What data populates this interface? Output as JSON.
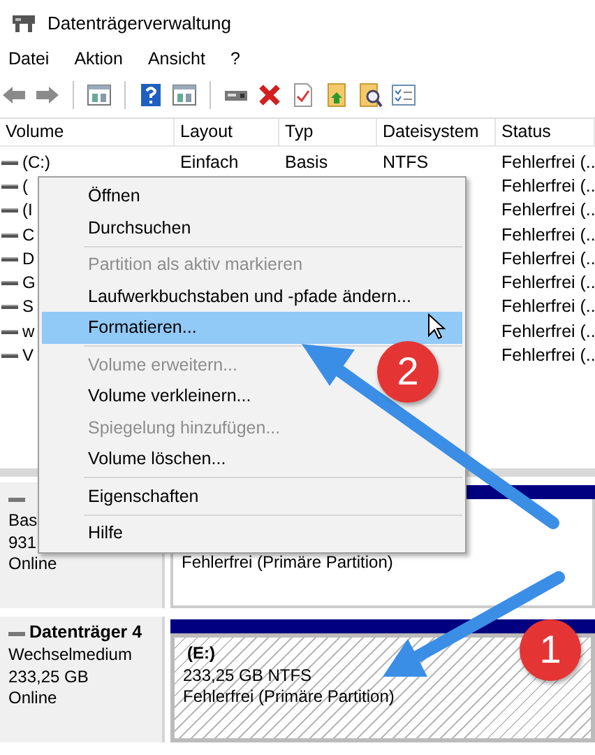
{
  "window": {
    "title": "Datenträgerverwaltung"
  },
  "menu_bar": [
    "Datei",
    "Aktion",
    "Ansicht",
    "?"
  ],
  "toolbar": [
    {
      "kind": "back"
    },
    {
      "kind": "forward"
    },
    {
      "kind": "separator"
    },
    {
      "kind": "panel"
    },
    {
      "kind": "separator"
    },
    {
      "kind": "help"
    },
    {
      "kind": "panel"
    },
    {
      "kind": "separator"
    },
    {
      "kind": "drive"
    },
    {
      "kind": "delete"
    },
    {
      "kind": "check"
    },
    {
      "kind": "folder-up"
    },
    {
      "kind": "folder-search"
    },
    {
      "kind": "list"
    }
  ],
  "volume_table": {
    "columns": [
      "Volume",
      "Layout",
      "Typ",
      "Dateisystem",
      "Status"
    ],
    "rows": [
      {
        "volume": "(C:)",
        "layout": "Einfach",
        "type": "Basis",
        "file_system": "NTFS",
        "status": "Fehlerfrei (.."
      },
      {
        "volume": "(",
        "status": "Fehlerfrei (.."
      },
      {
        "volume": "(I",
        "status": "Fehlerfrei (.."
      },
      {
        "volume": "C",
        "status": "Fehlerfrei (.."
      },
      {
        "volume": "D",
        "status": "Fehlerfrei (.."
      },
      {
        "volume": "G",
        "status": "Fehlerfrei (.."
      },
      {
        "volume": "S",
        "status": "Fehlerfrei (.."
      },
      {
        "volume": "w",
        "status": "Fehlerfrei (.."
      },
      {
        "volume": "V",
        "status": "Fehlerfrei (.."
      }
    ]
  },
  "disks": [
    {
      "type": "Bas",
      "size": "931",
      "status": "Online",
      "partitions": [
        {
          "status": "Fehlerfrei (Primäre Partition)",
          "selected": false
        }
      ]
    },
    {
      "name": "Datenträger 4",
      "type": "Wechselmedium",
      "size": "233,25 GB",
      "status": "Online",
      "partitions": [
        {
          "label": "(E:)",
          "size_fs": "233,25 GB NTFS",
          "status": "Fehlerfrei (Primäre Partition)",
          "selected": true
        }
      ]
    }
  ],
  "context_menu": [
    {
      "kind": "item",
      "label": "Öffnen",
      "disabled": false,
      "selected": false
    },
    {
      "kind": "item",
      "label": "Durchsuchen",
      "disabled": false,
      "selected": false
    },
    {
      "kind": "separator"
    },
    {
      "kind": "item",
      "label": "Partition als aktiv markieren",
      "disabled": true,
      "selected": false
    },
    {
      "kind": "item",
      "label": "Laufwerkbuchstaben und -pfade ändern...",
      "disabled": false,
      "selected": false
    },
    {
      "kind": "item",
      "label": "Formatieren...",
      "disabled": false,
      "selected": true
    },
    {
      "kind": "separator"
    },
    {
      "kind": "item",
      "label": "Volume erweitern...",
      "disabled": true,
      "selected": false
    },
    {
      "kind": "item",
      "label": "Volume verkleinern...",
      "disabled": false,
      "selected": false
    },
    {
      "kind": "item",
      "label": "Spiegelung hinzufügen...",
      "disabled": true,
      "selected": false
    },
    {
      "kind": "item",
      "label": "Volume löschen...",
      "disabled": false,
      "selected": false
    },
    {
      "kind": "separator"
    },
    {
      "kind": "item",
      "label": "Eigenschaften",
      "disabled": false,
      "selected": false
    },
    {
      "kind": "separator"
    },
    {
      "kind": "item",
      "label": "Hilfe",
      "disabled": false,
      "selected": false
    }
  ],
  "annotations": [
    {
      "label": "2"
    },
    {
      "label": "1"
    }
  ]
}
